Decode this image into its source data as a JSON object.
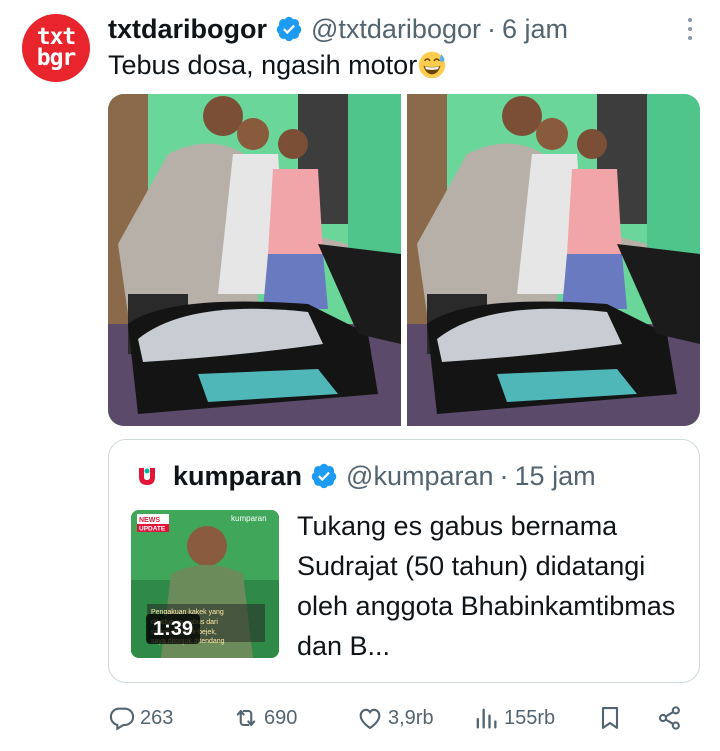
{
  "tweet": {
    "avatar": {
      "line1": "txt",
      "line2": "bgr"
    },
    "author": "txtdaribogor",
    "handle": "@txtdaribogor",
    "separator": "·",
    "time": "6 jam",
    "text": "Tebus dosa, ngasih motor",
    "emoji": "grinning-sweat-emoji",
    "images": [
      "photo-1",
      "photo-2"
    ]
  },
  "quote": {
    "author": "kumparan",
    "handle": "@kumparan",
    "separator": "·",
    "time": "15 jam",
    "text": "Tukang es gabus bernama Sudrajat (50 tahun) didatangi oleh anggota Bhabinkamtibmas dan B...",
    "video": {
      "duration": "1:39",
      "badge_top": "NEWS",
      "badge_bottom": "UPDATE",
      "brand": "kumparan",
      "caption": "Pengakuan kakek yang dituduh es gabus dari spons, dibejek-bejek, saya ditonjok ditendang"
    }
  },
  "actions": {
    "replies": "263",
    "reposts": "690",
    "likes": "3,9rb",
    "views": "155rb"
  },
  "colors": {
    "primary_text": "#0f1419",
    "secondary_text": "#536471",
    "verified": "#1d9bf0",
    "border": "#cfd9de",
    "avatar_bg": "#e8242c"
  }
}
